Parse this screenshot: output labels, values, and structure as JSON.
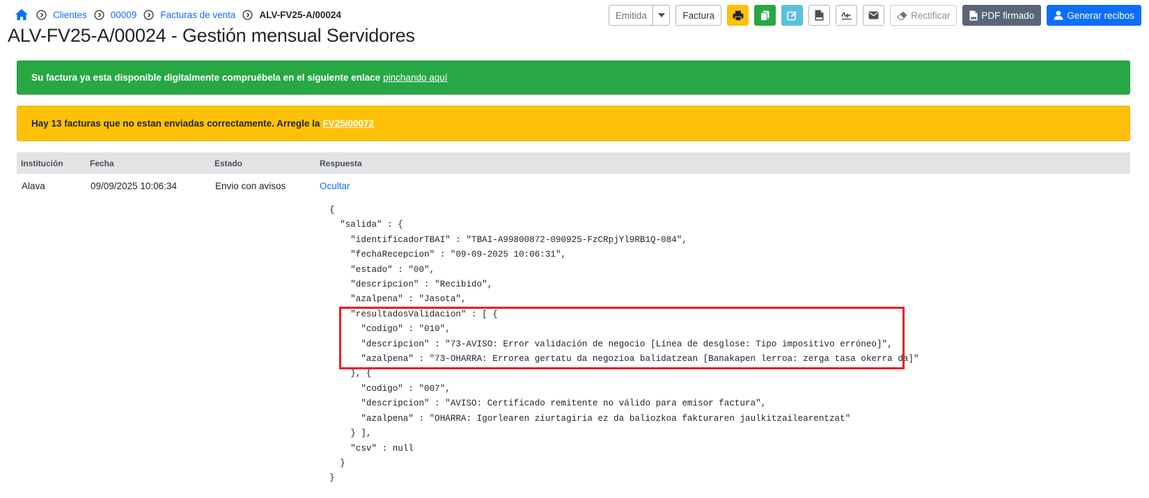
{
  "breadcrumb": {
    "items": [
      "Clientes",
      "00009",
      "Facturas de venta"
    ],
    "current": "ALV-FV25-A/00024"
  },
  "page": {
    "title": "ALV-FV25-A/00024 - Gestión mensual Servidores"
  },
  "toolbar": {
    "status_value": "Emitida",
    "factura_label": "Factura",
    "rectificar_label": "Rectificar",
    "pdf_firmado_label": "PDF firmado",
    "generar_recibos_label": "Generar recibos",
    "icons": [
      "print-icon",
      "copy-icon",
      "edit-icon",
      "xml-file-icon",
      "signature-icon",
      "envelope-icon",
      "eraser-icon",
      "pdf-file-icon",
      "user-icon"
    ]
  },
  "alerts": {
    "success_text": "Su factura ya esta disponible digitalmente compruébela en el siguiente enlace",
    "success_link": "pinchando aquí",
    "warning_text": "Hay 13 facturas que no estan enviadas correctamente. Arregle la",
    "warning_link": "FV25/00072"
  },
  "table": {
    "headers": {
      "institucion": "Institución",
      "fecha": "Fecha",
      "estado": "Estado",
      "respuesta": "Respuesta"
    },
    "row": {
      "institucion": "Alava",
      "fecha": "09/09/2025 10:06:34",
      "estado": "Envio con avisos",
      "respuesta_link": "Ocultar"
    },
    "response_json": "{\n  \"salida\" : {\n    \"identificadorTBAI\" : \"TBAI-A99800872-090925-FzCRpjYl9RB1Q-084\",\n    \"fechaRecepcion\" : \"09-09-2025 10:06:31\",\n    \"estado\" : \"00\",\n    \"descripcion\" : \"Recibido\",\n    \"azalpena\" : \"Jasota\",\n    \"resultadosValidacion\" : [ {\n      \"codigo\" : \"010\",\n      \"descripcion\" : \"73-AVISO: Error validación de negocio [Línea de desglose: Tipo impositivo erróneo]\",\n      \"azalpena\" : \"73-OHARRA: Errorea gertatu da negozioa balidatzean [Banakapen lerroa: zerga tasa okerra da]\"\n    }, {\n      \"codigo\" : \"007\",\n      \"descripcion\" : \"AVISO: Certificado remitente no válido para emisor factura\",\n      \"azalpena\" : \"OHARRA: Igorlearen ziurtagiria ez da baliozkoa fakturaren jaulkitzailearentzat\"\n    } ],\n    \"csv\" : null\n  }\n}"
  },
  "colors": {
    "primary": "#0d6efd",
    "success": "#28a745",
    "warning": "#ffc107",
    "info": "#5bc0de",
    "slate": "#5a6578",
    "highlight": "#ed1c24"
  }
}
